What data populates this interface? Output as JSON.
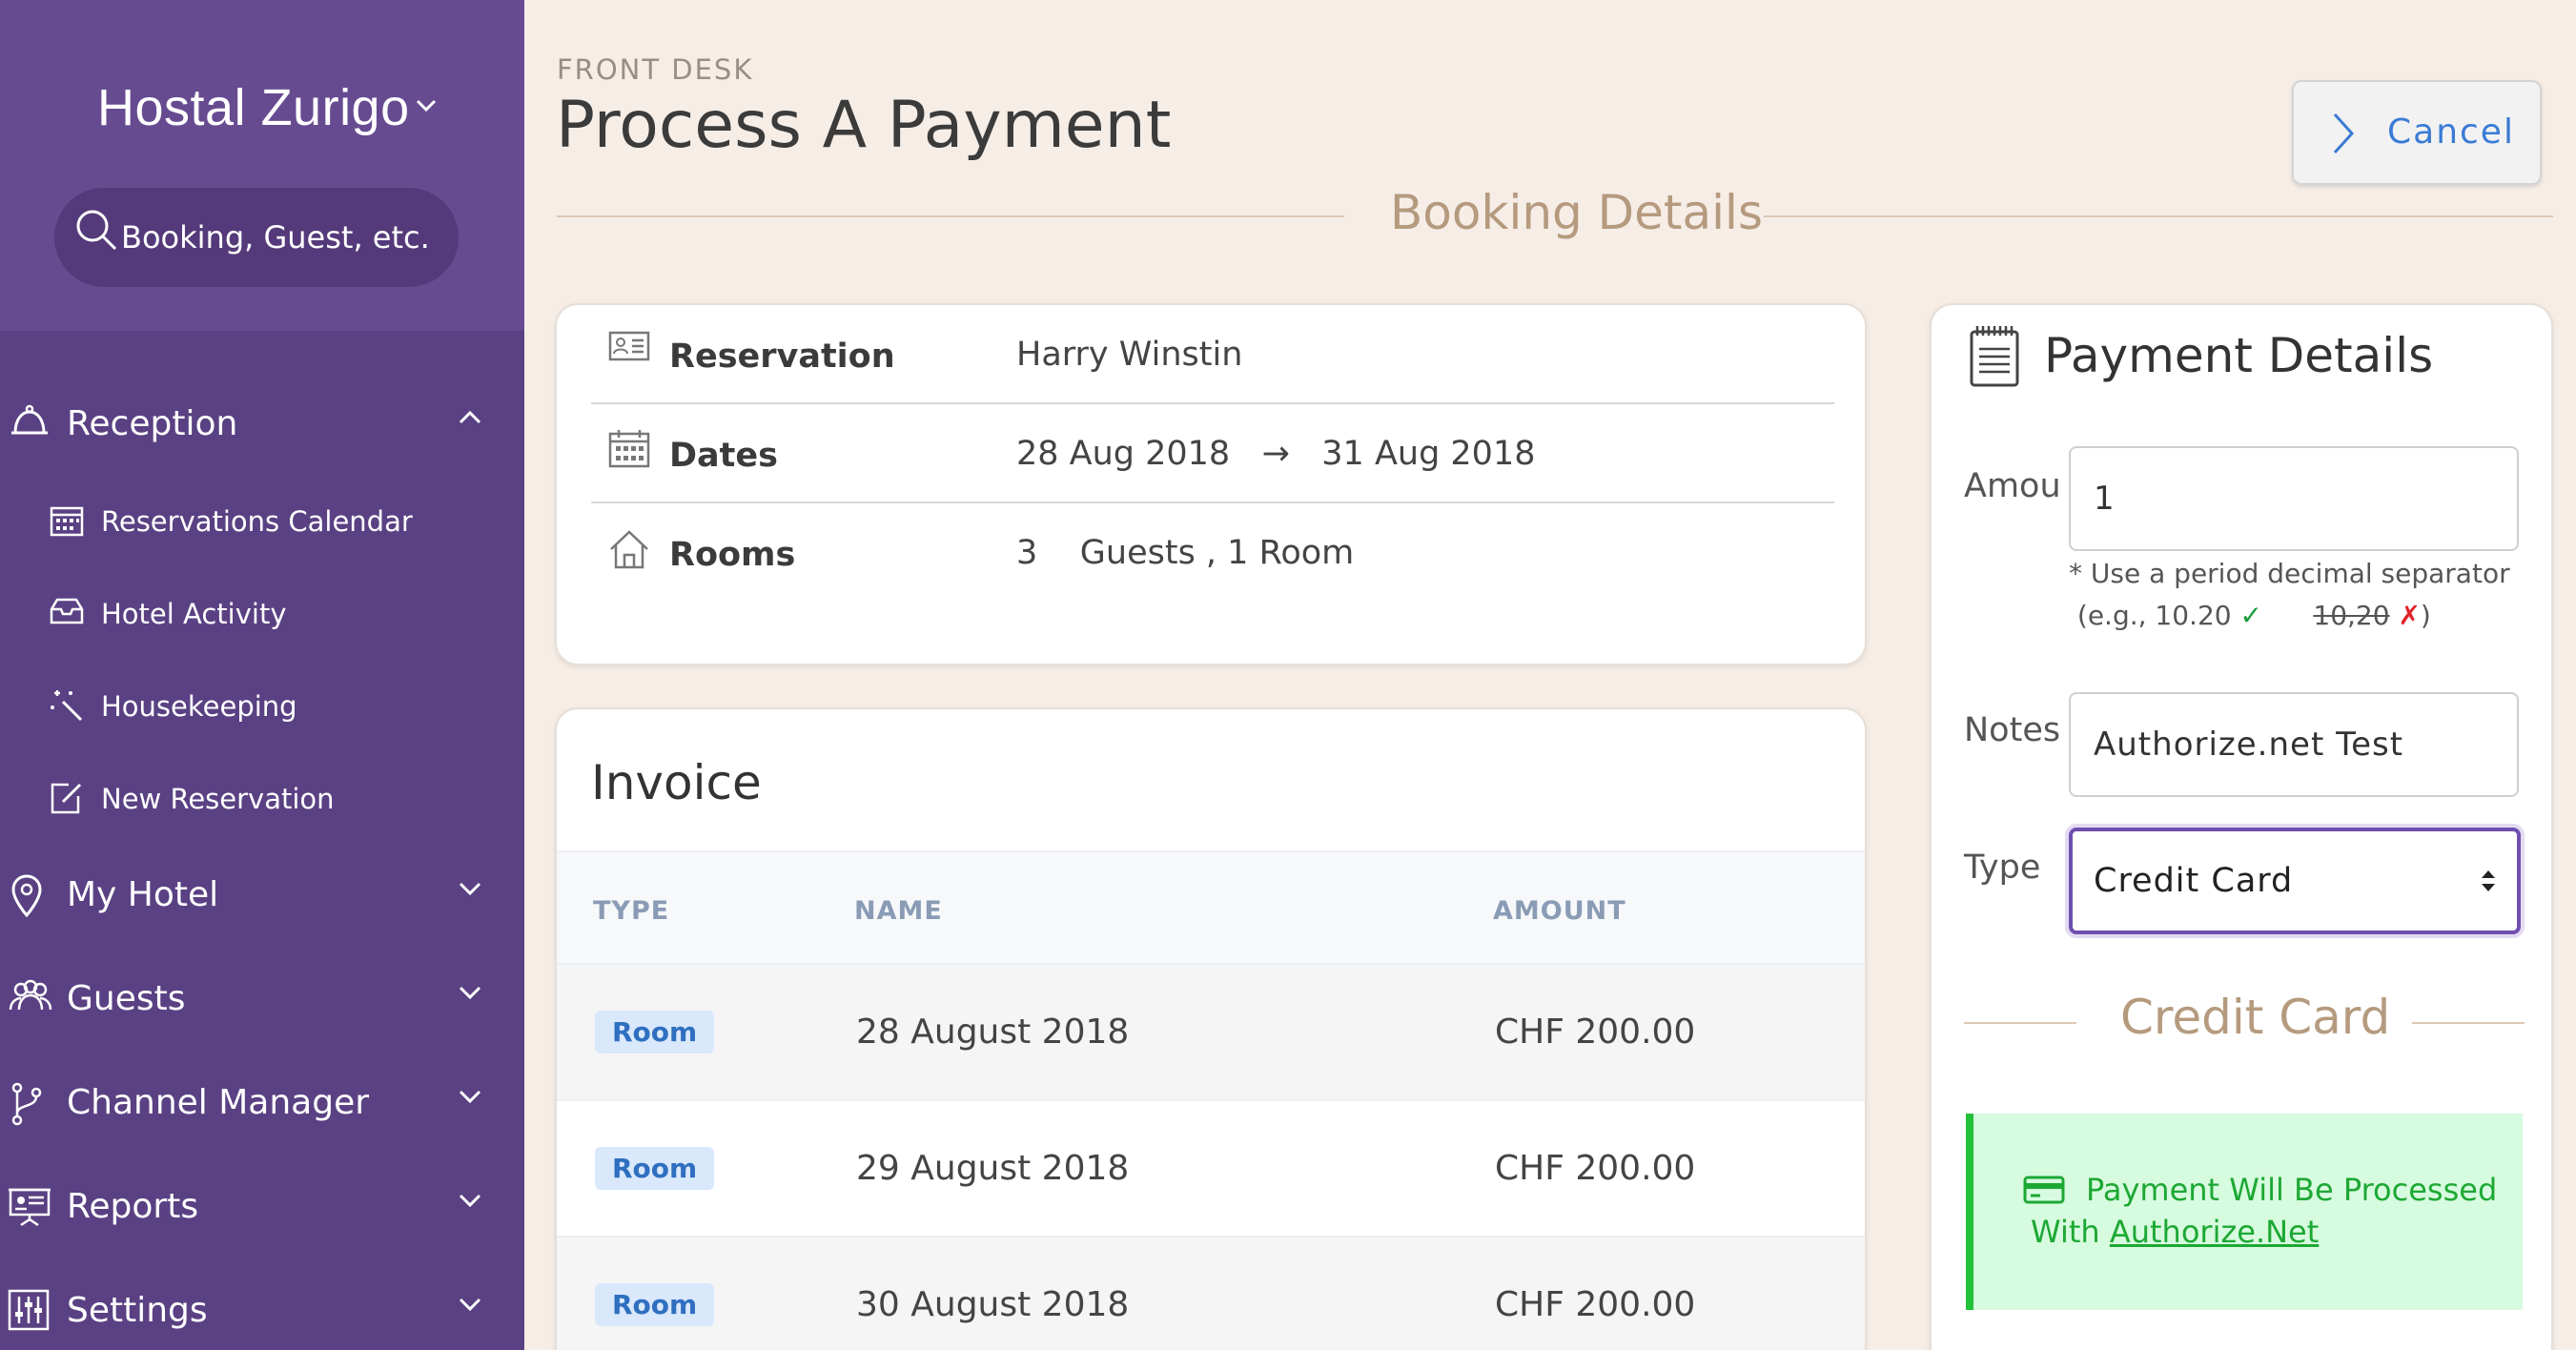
{
  "sidebar": {
    "hotel_name": "Hostal Zurigo",
    "search_placeholder": "Booking, Guest, etc.",
    "sections": [
      {
        "label": "Reception",
        "icon": "bell-icon",
        "expanded": true
      },
      {
        "label": "My Hotel",
        "icon": "map-pin-icon",
        "expanded": false
      },
      {
        "label": "Guests",
        "icon": "users-icon",
        "expanded": false
      },
      {
        "label": "Channel Manager",
        "icon": "branch-icon",
        "expanded": false
      },
      {
        "label": "Reports",
        "icon": "presentation-icon",
        "expanded": false
      },
      {
        "label": "Settings",
        "icon": "sliders-icon",
        "expanded": false
      }
    ],
    "reception_items": [
      {
        "label": "Reservations Calendar",
        "icon": "calendar-icon"
      },
      {
        "label": "Hotel Activity",
        "icon": "inbox-icon"
      },
      {
        "label": "Housekeeping",
        "icon": "magic-wand-icon"
      },
      {
        "label": "New Reservation",
        "icon": "edit-icon"
      }
    ]
  },
  "header": {
    "eyebrow": "FRONT DESK",
    "title": "Process A Payment",
    "cancel_label": "Cancel",
    "section_title": "Booking Details"
  },
  "booking": {
    "reservation_label": "Reservation",
    "reservation_value": "Harry Winstin",
    "dates_label": "Dates",
    "dates_value": "28 Aug 2018   →   31 Aug 2018",
    "rooms_label": "Rooms",
    "rooms_value": "3    Guests , 1 Room"
  },
  "invoice": {
    "title": "Invoice",
    "columns": [
      "TYPE",
      "NAME",
      "AMOUNT"
    ],
    "rows": [
      {
        "type": "Room",
        "name": "28 August 2018",
        "amount": "CHF 200.00"
      },
      {
        "type": "Room",
        "name": "29 August 2018",
        "amount": "CHF 200.00"
      },
      {
        "type": "Room",
        "name": "30 August 2018",
        "amount": "CHF 200.00"
      }
    ]
  },
  "payment": {
    "title": "Payment Details",
    "amount_label": "Amount",
    "amount_value": "1",
    "hint_line1": "* Use a period decimal separator",
    "hint_prefix": "(e.g., 10.20",
    "hint_ok": "✓",
    "hint_bad_example": "10,20",
    "hint_bad": "✗",
    "hint_suffix": ")",
    "notes_label": "Notes",
    "notes_value": "Authorize.net Test",
    "type_label": "Type",
    "type_value": "Credit Card",
    "section_title": "Credit Card",
    "notice_text": "Payment Will Be Processed With ",
    "notice_link": "Authorize.Net"
  },
  "colors": {
    "sidebar": "#5a4183",
    "accent": "#3a7bd5",
    "success": "#1da834",
    "background": "#f6ede7"
  }
}
